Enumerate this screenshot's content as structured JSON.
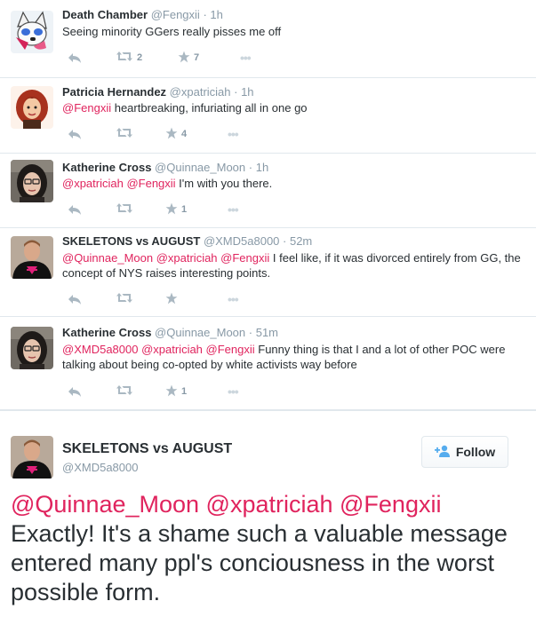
{
  "replies": [
    {
      "name": "Death Chamber",
      "handle": "@Fengxii",
      "time": "· 1h",
      "mentions": "",
      "text": "Seeing minority GGers really pisses me off",
      "retweets": "2",
      "favorites": "7"
    },
    {
      "name": "Patricia Hernandez",
      "handle": "@xpatriciah",
      "time": "· 1h",
      "mentions": "@Fengxii",
      "text": " heartbreaking, infuriating all in one go",
      "retweets": "",
      "favorites": "4"
    },
    {
      "name": "Katherine Cross",
      "handle": "@Quinnae_Moon",
      "time": "· 1h",
      "mentions": "@xpatriciah @Fengxii",
      "text": " I'm with you there.",
      "retweets": "",
      "favorites": "1"
    },
    {
      "name": "SKELETONS vs AUGUST",
      "handle": "@XMD5a8000",
      "time": "· 52m",
      "mentions": "@Quinnae_Moon @xpatriciah @Fengxii",
      "text": " I feel like, if it was divorced entirely from GG, the concept of NYS raises interesting points.",
      "retweets": "",
      "favorites": ""
    },
    {
      "name": "Katherine Cross",
      "handle": "@Quinnae_Moon",
      "time": "· 51m",
      "mentions": "@XMD5a8000 @xpatriciah @Fengxii",
      "text": " Funny thing is that I and a lot of other POC were talking about being co-opted by white activists way before",
      "retweets": "",
      "favorites": "1"
    }
  ],
  "main": {
    "name": "SKELETONS vs AUGUST",
    "handle": "@XMD5a8000",
    "follow_label": "Follow",
    "mentions": "@Quinnae_Moon @xpatriciah @Fengxii",
    "text": "Exactly! It's a shame such a valuable message entered many ppl's conciousness in the worst possible form."
  },
  "icons": {
    "reply": "reply-icon",
    "retweet": "retweet-icon",
    "favorite": "star-icon",
    "more": "more-dots-icon",
    "follow": "add-user-icon"
  },
  "colors": {
    "mention": "#e0245e",
    "icon": "#aab8c2",
    "follow_icon": "#55acee"
  }
}
